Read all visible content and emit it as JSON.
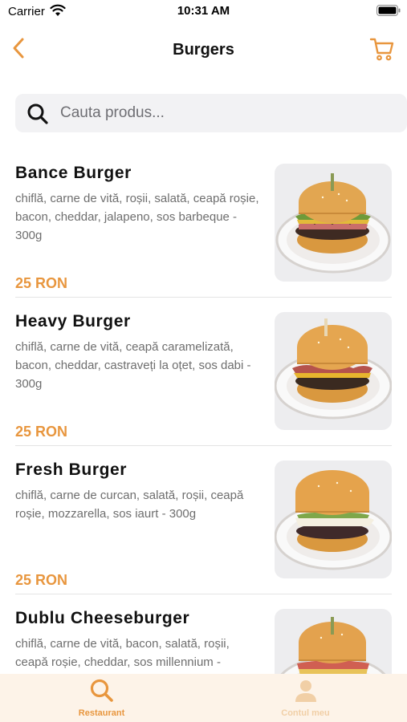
{
  "status_bar": {
    "carrier": "Carrier",
    "time": "10:31 AM"
  },
  "nav": {
    "title": "Burgers",
    "back_icon": "chevron-left-icon",
    "cart_icon": "cart-icon"
  },
  "search": {
    "placeholder": "Cauta produs...",
    "value": "",
    "icon": "search-icon"
  },
  "products": [
    {
      "name": "Bance Burger",
      "description": "chiflă, carne de vită, roșii, salată, ceapă roșie, bacon, cheddar, jalapeno, sos barbeque - 300g",
      "price": "25 RON"
    },
    {
      "name": "Heavy Burger",
      "description": "chiflă, carne de vită, ceapă caramelizată, bacon, cheddar, castraveți la oțet, sos dabi - 300g",
      "price": "25 RON"
    },
    {
      "name": "Fresh Burger",
      "description": "chiflă, carne de curcan, salată, roșii, ceapă roșie, mozzarella, sos iaurt - 300g",
      "price": "25 RON"
    },
    {
      "name": "Dublu Cheeseburger",
      "description": "chiflă, carne de vită, bacon, salată, roșii, ceapă roșie, cheddar, sos millennium -",
      "price": ""
    }
  ],
  "tab_bar": {
    "tabs": [
      {
        "label": "Restaurant",
        "icon": "search-icon",
        "active": true
      },
      {
        "label": "Contul meu",
        "icon": "user-icon",
        "active": false
      }
    ]
  },
  "colors": {
    "accent": "#e8963e",
    "accent_light": "#f1cfa6",
    "tab_background": "#fdf3e8",
    "search_background": "#f2f2f4"
  }
}
